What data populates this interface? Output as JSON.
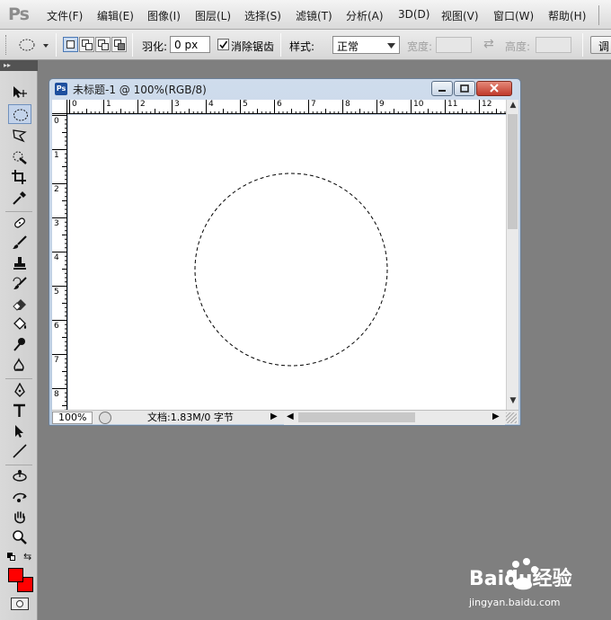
{
  "app": {
    "logo": "Ps"
  },
  "menu": [
    {
      "label": "文件(F)"
    },
    {
      "label": "编辑(E)"
    },
    {
      "label": "图像(I)"
    },
    {
      "label": "图层(L)"
    },
    {
      "label": "选择(S)"
    },
    {
      "label": "滤镜(T)"
    },
    {
      "label": "分析(A)"
    },
    {
      "label": "3D(D)"
    },
    {
      "label": "视图(V)"
    },
    {
      "label": "窗口(W)"
    },
    {
      "label": "帮助(H)"
    }
  ],
  "options": {
    "feather_label": "羽化:",
    "feather_value": "0 px",
    "antialias_label": "消除锯齿",
    "antialias_checked": true,
    "style_label": "样式:",
    "style_value": "正常",
    "width_label": "宽度:",
    "height_label": "高度:",
    "swap_glyph": "⇄",
    "refine_label": "调"
  },
  "tools": [
    "move-tool",
    "elliptical-marquee-tool",
    "lasso-tool",
    "quick-selection-tool",
    "crop-tool",
    "eyedropper-tool",
    "healing-brush-tool",
    "brush-tool",
    "clone-stamp-tool",
    "history-brush-tool",
    "eraser-tool",
    "paint-bucket-tool",
    "dodge-tool",
    "burn-tool",
    "pen-tool",
    "type-tool",
    "path-selection-tool",
    "line-tool",
    "3d-rotate-tool",
    "3d-orbit-tool",
    "hand-tool",
    "zoom-tool"
  ],
  "document": {
    "title": "未标题-1 @ 100%(RGB/8)",
    "ps_icon": "Ps",
    "ruler_x": [
      "0",
      "1",
      "2",
      "3",
      "4",
      "5",
      "6",
      "7",
      "8",
      "9",
      "10",
      "11",
      "12"
    ],
    "ruler_y": [
      "0",
      "1",
      "2",
      "3",
      "4",
      "5",
      "6",
      "7",
      "8"
    ],
    "zoom": "100%",
    "doc_info": "文档:1.83M/0 字节",
    "selection": {
      "shape": "ellipse",
      "style": "marching-ants"
    }
  },
  "colors": {
    "foreground": "#ff0000",
    "background": "#ff0000",
    "workspace": "#7f7f7f"
  },
  "watermark": {
    "brand": "Baidu经验",
    "url": "jingyan.baidu.com"
  }
}
